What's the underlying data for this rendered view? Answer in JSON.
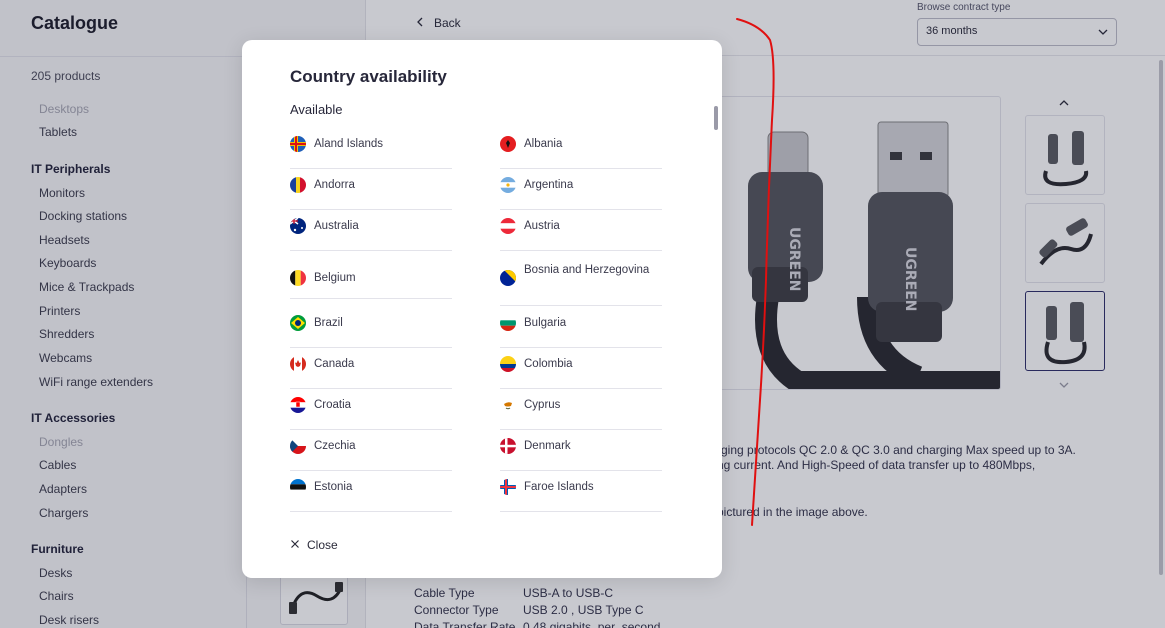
{
  "sidebar": {
    "title": "Catalogue",
    "product_count": "205 products",
    "items": [
      {
        "label": "Desktops",
        "kind": "item-dim"
      },
      {
        "label": "Tablets",
        "kind": "item"
      },
      {
        "label": "IT Peripherals",
        "kind": "head"
      },
      {
        "label": "Monitors",
        "kind": "item"
      },
      {
        "label": "Docking stations",
        "kind": "item"
      },
      {
        "label": "Headsets",
        "kind": "item"
      },
      {
        "label": "Keyboards",
        "kind": "item"
      },
      {
        "label": "Mice & Trackpads",
        "kind": "item"
      },
      {
        "label": "Printers",
        "kind": "item"
      },
      {
        "label": "Shredders",
        "kind": "item"
      },
      {
        "label": "Webcams",
        "kind": "item"
      },
      {
        "label": "WiFi range extenders",
        "kind": "item"
      },
      {
        "label": "IT Accessories",
        "kind": "head"
      },
      {
        "label": "Dongles",
        "kind": "item-dim"
      },
      {
        "label": "Cables",
        "kind": "item"
      },
      {
        "label": "Adapters",
        "kind": "item"
      },
      {
        "label": "Chargers",
        "kind": "item"
      },
      {
        "label": "Furniture",
        "kind": "head"
      },
      {
        "label": "Desks",
        "kind": "item"
      },
      {
        "label": "Chairs",
        "kind": "item"
      },
      {
        "label": "Desk risers",
        "kind": "item"
      }
    ]
  },
  "header": {
    "back_label": "Back",
    "contract_label": "Browse contract type",
    "contract_value": "36 months"
  },
  "product": {
    "brand_text": "UGREEN",
    "desc_line1": "rging protocols QC 2.0 & QC 3.0 and charging Max speed up to 3A.",
    "desc_line2": "ng current. And High-Speed of data transfer up to 480Mbps,",
    "desc_line3": "pictured in the image above.",
    "specs": [
      {
        "key": "Cable Type",
        "value": "USB-A to USB-C"
      },
      {
        "key": "Connector Type",
        "value": "USB 2.0 , USB Type C"
      },
      {
        "key": "Data Transfer Rate",
        "value": "0.48 gigabits_per_second"
      }
    ]
  },
  "modal": {
    "title": "Country availability",
    "subtitle": "Available",
    "close_label": "Close",
    "countries": [
      {
        "name": "Aland Islands",
        "flag": "aland-islands-flag"
      },
      {
        "name": "Albania",
        "flag": "albania-flag"
      },
      {
        "name": "Andorra",
        "flag": "andorra-flag"
      },
      {
        "name": "Argentina",
        "flag": "argentina-flag"
      },
      {
        "name": "Australia",
        "flag": "australia-flag"
      },
      {
        "name": "Austria",
        "flag": "austria-flag"
      },
      {
        "name": "Belgium",
        "flag": "belgium-flag"
      },
      {
        "name": "Bosnia and Herzegovina",
        "flag": "bosnia-flag"
      },
      {
        "name": "Brazil",
        "flag": "brazil-flag"
      },
      {
        "name": "Bulgaria",
        "flag": "bulgaria-flag"
      },
      {
        "name": "Canada",
        "flag": "canada-flag"
      },
      {
        "name": "Colombia",
        "flag": "colombia-flag"
      },
      {
        "name": "Croatia",
        "flag": "croatia-flag"
      },
      {
        "name": "Cyprus",
        "flag": "cyprus-flag"
      },
      {
        "name": "Czechia",
        "flag": "czechia-flag"
      },
      {
        "name": "Denmark",
        "flag": "denmark-flag"
      },
      {
        "name": "Estonia",
        "flag": "estonia-flag"
      },
      {
        "name": "Faroe Islands",
        "flag": "faroe-islands-flag"
      }
    ]
  },
  "colors": {
    "overlay": "#191c37",
    "accent_selected": "#2f2f6a",
    "annotation": "#e01010"
  }
}
